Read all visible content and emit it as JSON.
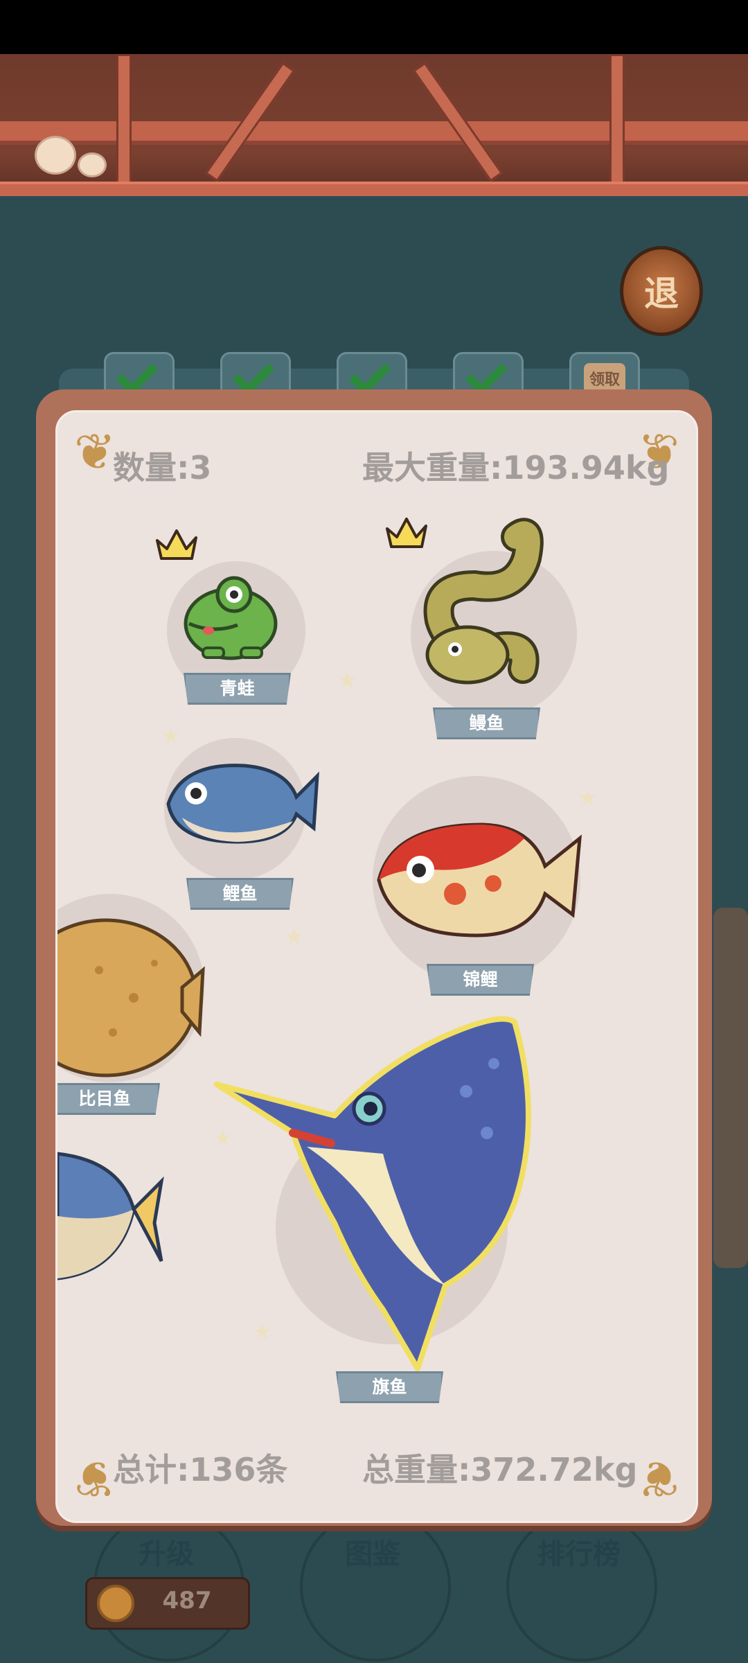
{
  "top_bar": {
    "exit_label": "退"
  },
  "tabs": [
    {
      "icon": "check-icon"
    },
    {
      "icon": "check-icon"
    },
    {
      "icon": "check-icon"
    },
    {
      "icon": "check-icon"
    },
    {
      "label": "领取"
    }
  ],
  "panel": {
    "count": "数量:3",
    "max_weight": "最大重量:193.94kg",
    "total_count": "总计:136条",
    "total_weight": "总重量:372.72kg"
  },
  "fish": [
    {
      "name": "青蛙",
      "crown": true
    },
    {
      "name": "鳗鱼",
      "crown": true
    },
    {
      "name": "鲤鱼",
      "crown": false
    },
    {
      "name": "锦鲤",
      "crown": false
    },
    {
      "name": "比目鱼",
      "crown": false
    },
    {
      "name": "旗鱼",
      "crown": false
    }
  ],
  "bottom_nav": [
    {
      "label": "升级"
    },
    {
      "label": "图鉴"
    },
    {
      "label": "排行榜"
    }
  ],
  "currency": {
    "value": "487",
    "icon": "coin-icon"
  },
  "colors": {
    "panel_border": "#b0715a",
    "panel_bg": "#ece2de",
    "label_bg": "#8ea1ae",
    "stat_text": "#a29d9a"
  }
}
